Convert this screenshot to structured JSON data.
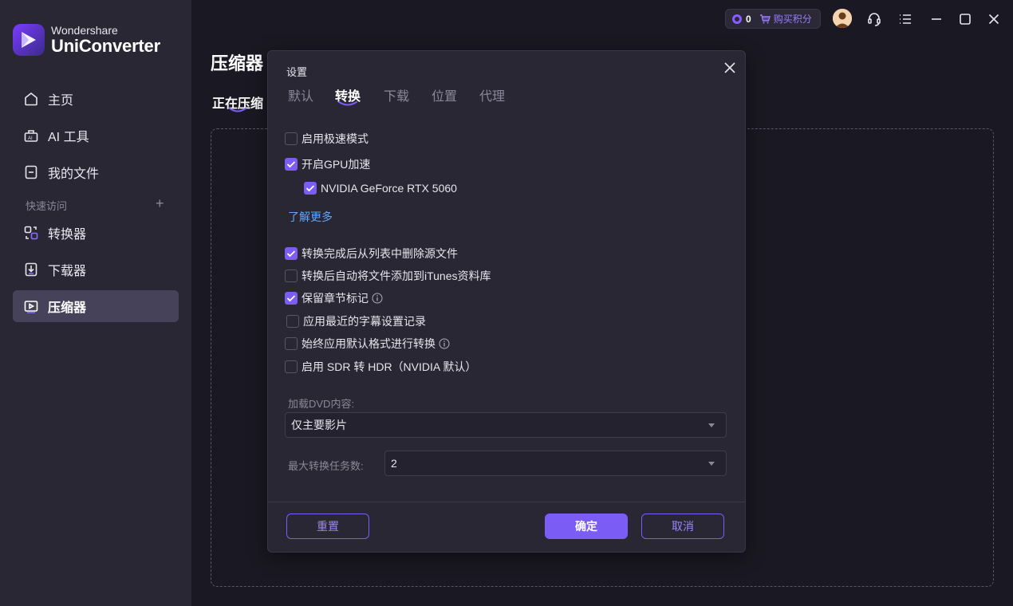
{
  "app": {
    "brand_line1": "Wondershare",
    "brand_line2": "UniConverter"
  },
  "sidebar": {
    "items": [
      {
        "label": "主页",
        "icon": "home-icon"
      },
      {
        "label": "AI 工具",
        "icon": "ai-tools-icon"
      },
      {
        "label": "我的文件",
        "icon": "my-files-icon"
      }
    ],
    "quick_access_title": "快速访问",
    "quick_items": [
      {
        "label": "转换器",
        "icon": "converter-icon"
      },
      {
        "label": "下载器",
        "icon": "downloader-icon"
      },
      {
        "label": "压缩器",
        "icon": "compressor-icon",
        "active": true
      }
    ]
  },
  "main": {
    "title": "压缩器",
    "subtab": "正在压缩"
  },
  "topbar": {
    "points": "0",
    "buy_points": "购买积分"
  },
  "dialog": {
    "title": "设置",
    "tabs": [
      {
        "label": "默认"
      },
      {
        "label": "转换",
        "active": true
      },
      {
        "label": "下载"
      },
      {
        "label": "位置"
      },
      {
        "label": "代理"
      }
    ],
    "options": {
      "fast_mode": {
        "label": "启用极速模式",
        "checked": false
      },
      "gpu_accel": {
        "label": "开启GPU加速",
        "checked": true
      },
      "gpu_device": {
        "label": "NVIDIA GeForce RTX 5060",
        "checked": true
      },
      "learn_more": "了解更多",
      "delete_source": {
        "label": "转换完成后从列表中删除源文件",
        "checked": true
      },
      "add_itunes": {
        "label": "转换后自动将文件添加到iTunes资料库",
        "checked": false
      },
      "keep_chapters": {
        "label": "保留章节标记",
        "checked": true
      },
      "recent_subtitle": {
        "label": "应用最近的字幕设置记录",
        "checked": false
      },
      "default_format": {
        "label": "始终应用默认格式进行转换",
        "checked": false
      },
      "sdr_hdr": {
        "label": "启用 SDR 转 HDR（NVIDIA 默认）",
        "checked": false
      }
    },
    "dvd_label": "加载DVD内容:",
    "dvd_value": "仅主要影片",
    "max_tasks_label": "最大转换任务数:",
    "max_tasks_value": "2",
    "buttons": {
      "reset": "重置",
      "ok": "确定",
      "cancel": "取消"
    }
  },
  "colors": {
    "accent": "#7b5cf5",
    "link": "#5ea7ff",
    "sidebar_bg": "#2a2734",
    "main_bg": "#1a1822"
  }
}
